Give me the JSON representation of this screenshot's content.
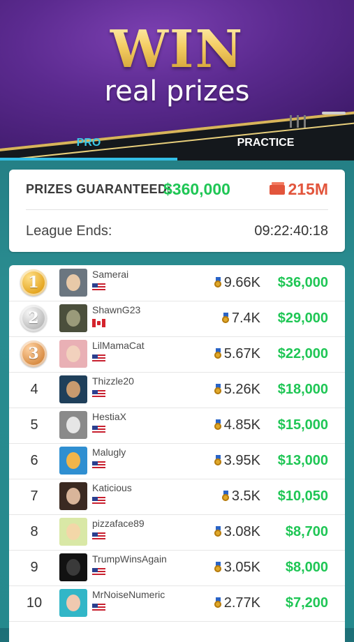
{
  "banner": {
    "title": "WIN",
    "subtitle": "real prizes"
  },
  "tabs": [
    {
      "label": "PRO",
      "active": true
    },
    {
      "label": "PRACTICE",
      "active": false
    }
  ],
  "prize_card": {
    "guaranteed_label": "PRIZES GUARANTEED:",
    "guaranteed_amount": "$360,000",
    "chips": "215M",
    "league_label": "League Ends:",
    "league_time": "09:22:40:18"
  },
  "leaderboard": [
    {
      "rank": "1",
      "medal": "gold",
      "name": "Samerai",
      "flag": "us",
      "score": "9.66K",
      "prize": "$36,000"
    },
    {
      "rank": "2",
      "medal": "silver",
      "name": "ShawnG23",
      "flag": "ca",
      "score": "7.4K",
      "prize": "$29,000"
    },
    {
      "rank": "3",
      "medal": "bronze",
      "name": "LilMamaCat",
      "flag": "us",
      "score": "5.67K",
      "prize": "$22,000"
    },
    {
      "rank": "4",
      "medal": "",
      "name": "Thizzle20",
      "flag": "us",
      "score": "5.26K",
      "prize": "$18,000"
    },
    {
      "rank": "5",
      "medal": "",
      "name": "HestiaX",
      "flag": "us",
      "score": "4.85K",
      "prize": "$15,000"
    },
    {
      "rank": "6",
      "medal": "",
      "name": "Malugly",
      "flag": "us",
      "score": "3.95K",
      "prize": "$13,000"
    },
    {
      "rank": "7",
      "medal": "",
      "name": "Katicious",
      "flag": "us",
      "score": "3.5K",
      "prize": "$10,050"
    },
    {
      "rank": "8",
      "medal": "",
      "name": "pizzaface89",
      "flag": "us",
      "score": "3.08K",
      "prize": "$8,700"
    },
    {
      "rank": "9",
      "medal": "",
      "name": "TrumpWinsAgain",
      "flag": "us",
      "score": "3.05K",
      "prize": "$8,000"
    },
    {
      "rank": "10",
      "medal": "",
      "name": "MrNoiseNumeric",
      "flag": "us",
      "score": "2.77K",
      "prize": "$7,200"
    }
  ],
  "colors": {
    "accent_green": "#1fc655",
    "chips_red": "#e2553c",
    "tab_blue": "#33bfe6",
    "banner_purple": "#5b2a8f"
  }
}
